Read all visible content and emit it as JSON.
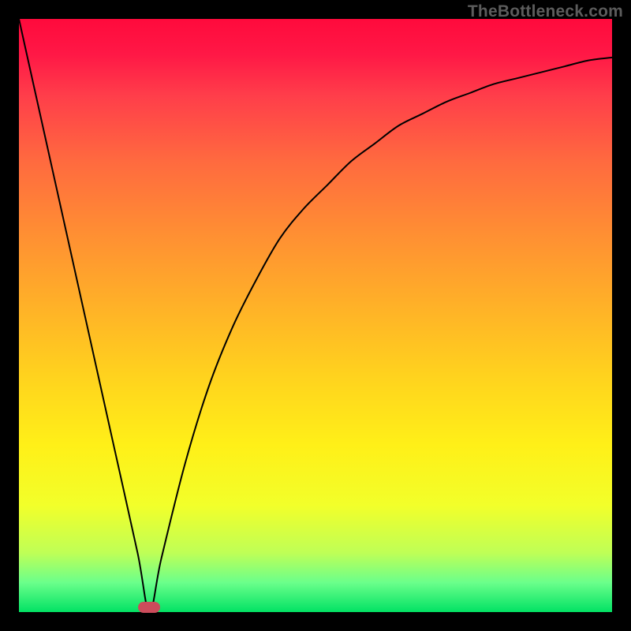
{
  "attribution": "TheBottleneck.com",
  "accent": {
    "marker_color": "#cc4c5b",
    "curve_color": "#000000"
  },
  "chart_data": {
    "type": "line",
    "title": "",
    "xlabel": "",
    "ylabel": "",
    "xlim": [
      0,
      100
    ],
    "ylim": [
      0,
      100
    ],
    "x_min_point": 22,
    "series": [
      {
        "name": "curve",
        "x": [
          0,
          4,
          8,
          12,
          16,
          20,
          22,
          24,
          28,
          32,
          36,
          40,
          44,
          48,
          52,
          56,
          60,
          64,
          68,
          72,
          76,
          80,
          84,
          88,
          92,
          96,
          100
        ],
        "values": [
          100,
          82,
          64,
          46,
          28,
          10,
          0,
          9,
          25,
          38,
          48,
          56,
          63,
          68,
          72,
          76,
          79,
          82,
          84,
          86,
          87.5,
          89,
          90,
          91,
          92,
          93,
          93.5
        ]
      }
    ],
    "marker": {
      "x": 22,
      "y": 0
    }
  }
}
